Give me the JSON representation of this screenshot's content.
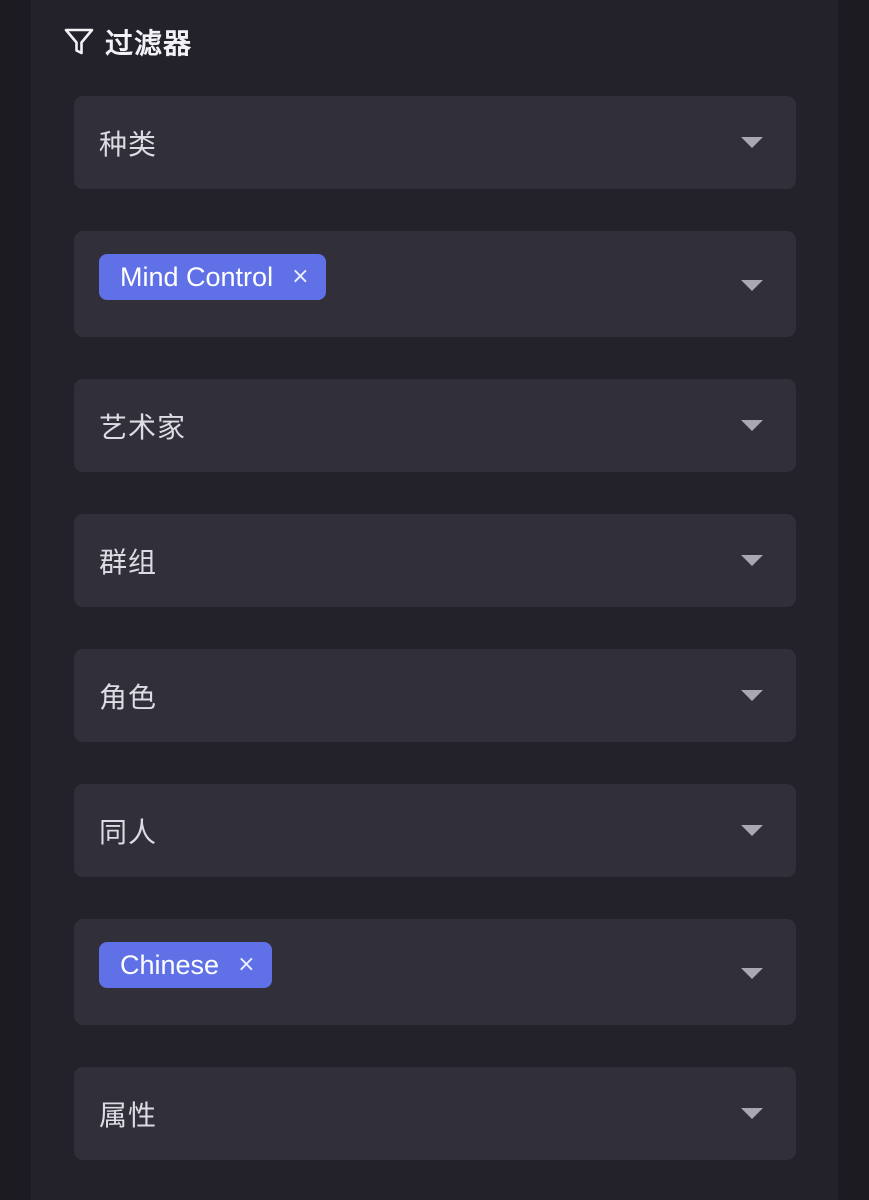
{
  "filter_panel": {
    "title": "过滤器",
    "icon": "filter-icon",
    "fields": [
      {
        "id": "category",
        "placeholder": "种类",
        "selected": []
      },
      {
        "id": "tags",
        "placeholder": "",
        "selected": [
          "Mind Control"
        ]
      },
      {
        "id": "artist",
        "placeholder": "艺术家",
        "selected": []
      },
      {
        "id": "group",
        "placeholder": "群组",
        "selected": []
      },
      {
        "id": "character",
        "placeholder": "角色",
        "selected": []
      },
      {
        "id": "parody",
        "placeholder": "同人",
        "selected": []
      },
      {
        "id": "language",
        "placeholder": "",
        "selected": [
          "Chinese"
        ]
      },
      {
        "id": "attribute",
        "placeholder": "属性",
        "selected": []
      }
    ],
    "chip_remove_glyph": "×"
  },
  "colors": {
    "background": "#1c1b21",
    "panel": "#232129",
    "field": "#312f39",
    "chip": "#6070e6",
    "text": "#e8e7ee"
  }
}
